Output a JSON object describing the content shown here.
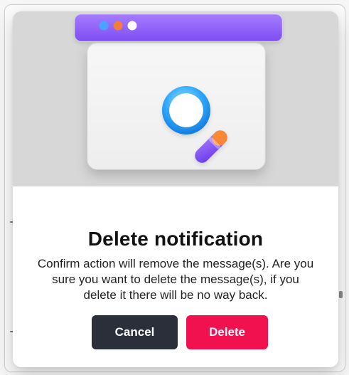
{
  "modal": {
    "title": "Delete notification",
    "message": "Confirm action will remove the message(s). Are you sure you want to delete the message(s), if you delete it there will be no way back.",
    "buttons": {
      "cancel_label": "Cancel",
      "delete_label": "Delete"
    },
    "illustration": {
      "icon": "magnifying-glass-window-icon"
    }
  },
  "colors": {
    "accent_purple": "#8b5cf6",
    "delete_pink": "#f2114f",
    "cancel_dark": "#2b2f3a",
    "traffic_blue": "#4aa3ff",
    "traffic_orange": "#f57c3a",
    "traffic_white": "#ffffff",
    "overlay_gray": "#d7d7d7",
    "background_red_dot": "#d32c3a"
  }
}
